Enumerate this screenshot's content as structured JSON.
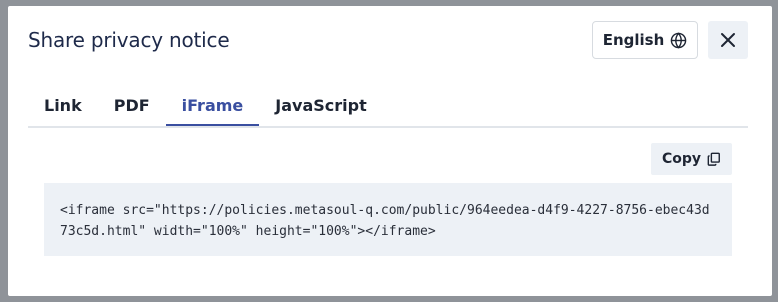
{
  "modal": {
    "title": "Share privacy notice",
    "language_label": "English",
    "tabs": [
      {
        "label": "Link"
      },
      {
        "label": "PDF"
      },
      {
        "label": "iFrame",
        "active": true
      },
      {
        "label": "JavaScript"
      }
    ],
    "copy_label": "Copy",
    "code": "<iframe src=\"https://policies.metasoul-q.com/public/964eedea-d4f9-4227-8756-ebec43d73c5d.html\" width=\"100%\" height=\"100%\"></iframe>"
  },
  "icons": {
    "language": "globe-icon",
    "close": "close-icon",
    "copy": "copy-icon"
  },
  "colors": {
    "accent": "#3a4fa0",
    "overlay": "#8f9399",
    "code_bg": "#edf1f6"
  }
}
